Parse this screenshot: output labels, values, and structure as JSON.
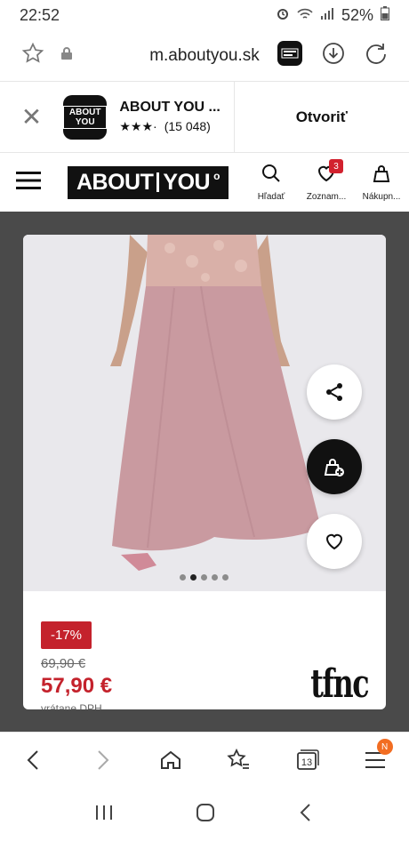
{
  "status": {
    "time": "22:52",
    "battery": "52%"
  },
  "browser": {
    "url": "m.aboutyou.sk",
    "tab_count": "13",
    "menu_badge": "N"
  },
  "app_banner": {
    "name": "ABOUT YOU ...",
    "rating_count": "(15 048)",
    "open_label": "Otvoriť",
    "icon_text": "ABOUT YOU"
  },
  "header": {
    "logo_left": "ABOUT",
    "logo_right": "YOU",
    "search_label": "Hľadať",
    "wishlist_label": "Zoznam...",
    "wishlist_count": "3",
    "cart_label": "Nákupn..."
  },
  "product": {
    "discount": "-17%",
    "old_price": "69,90 €",
    "price": "57,90 €",
    "vat_note": "vrátane DPH",
    "brand": "tfnc",
    "gallery_count": 5,
    "gallery_active": 1
  },
  "colors": {
    "accent": "#c4222c",
    "badge": "#d2212e",
    "dress": "#c99aa0",
    "backdrop": "#4a4a4a"
  }
}
